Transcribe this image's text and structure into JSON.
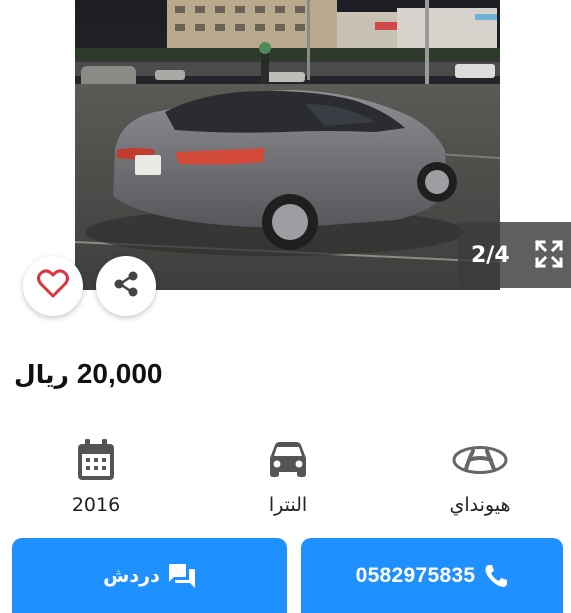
{
  "gallery": {
    "counter": "2/4",
    "photo_subject": "car-photo",
    "icons": {
      "prev": "chevron-left-icon",
      "next": "chevron-right-icon",
      "expand": "expand-icon",
      "favorite": "heart-icon",
      "share": "share-icon"
    }
  },
  "listing": {
    "price": "20,000",
    "currency": "ريال"
  },
  "specs": {
    "year": {
      "value": "2016",
      "icon": "calendar-icon"
    },
    "model": {
      "value": "النترا",
      "icon": "car-icon"
    },
    "make": {
      "value": "هيونداي",
      "icon": "hyundai-logo-icon"
    }
  },
  "actions": {
    "chat_label": "دردش",
    "call_label": "0582975835"
  },
  "colors": {
    "accent": "#1e90ff",
    "heart": "#d9343f"
  }
}
